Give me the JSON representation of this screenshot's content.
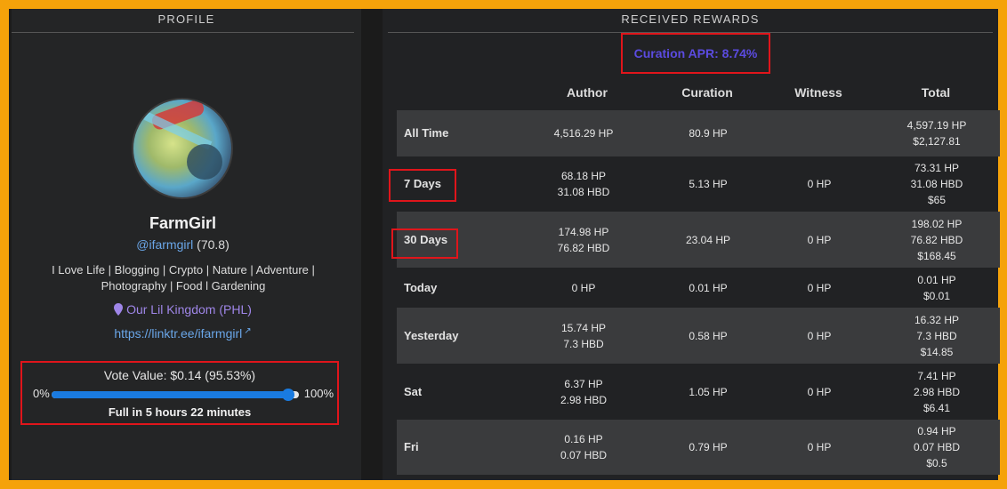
{
  "profile": {
    "section_title": "PROFILE",
    "avatar": "avatar-image",
    "name": "FarmGirl",
    "handle": "@ifarmgirl",
    "reputation": "(70.8)",
    "bio": "I Love Life | Blogging | Crypto | Nature | Adventure | Photography | Food l Gardening",
    "location": "Our Lil Kingdom (PHL)",
    "location_icon": "map-pin-icon",
    "website": "https://linktr.ee/ifarmgirl",
    "website_icon": "external-link-icon"
  },
  "vote": {
    "value_text": "Vote Value: $0.14 (95.53%)",
    "min_label": "0%",
    "max_label": "100%",
    "level_percent": 95.53,
    "full_in": "Full in 5 hours 22 minutes",
    "slider_color": "#1a7be0"
  },
  "rewards": {
    "section_title": "RECEIVED REWARDS",
    "curation_apr": "Curation APR: 8.74%",
    "columns": [
      "Author",
      "Curation",
      "Witness",
      "Total"
    ],
    "rows": [
      {
        "label": "All Time",
        "author": "4,516.29 HP",
        "curation": "80.9 HP",
        "witness": "",
        "total": [
          "4,597.19 HP",
          "$2,127.81"
        ]
      },
      {
        "label": "7 Days",
        "author": "68.18 HP\n31.08 HBD",
        "curation": "5.13 HP",
        "witness": "0 HP",
        "total": [
          "73.31 HP",
          "31.08 HBD",
          "$65"
        ]
      },
      {
        "label": "30 Days",
        "author": "174.98 HP\n76.82 HBD",
        "curation": "23.04 HP",
        "witness": "0 HP",
        "total": [
          "198.02 HP",
          "76.82 HBD",
          "$168.45"
        ]
      },
      {
        "label": "Today",
        "author": "0 HP",
        "curation": "0.01 HP",
        "witness": "0 HP",
        "total": [
          "0.01 HP",
          "$0.01"
        ]
      },
      {
        "label": "Yesterday",
        "author": "15.74 HP\n7.3 HBD",
        "curation": "0.58 HP",
        "witness": "0 HP",
        "total": [
          "16.32 HP",
          "7.3 HBD",
          "$14.85"
        ]
      },
      {
        "label": "Sat",
        "author": "6.37 HP\n2.98 HBD",
        "curation": "1.05 HP",
        "witness": "0 HP",
        "total": [
          "7.41 HP",
          "2.98 HBD",
          "$6.41"
        ]
      },
      {
        "label": "Fri",
        "author": "0.16 HP\n0.07 HBD",
        "curation": "0.79 HP",
        "witness": "0 HP",
        "total": [
          "0.94 HP",
          "0.07 HBD",
          "$0.5"
        ]
      }
    ]
  },
  "colors": {
    "highlight": "#e0151b",
    "link": "#6aa6e8",
    "location": "#9f86e8",
    "apr": "#5b4be0",
    "frame": "#f5a20a"
  }
}
